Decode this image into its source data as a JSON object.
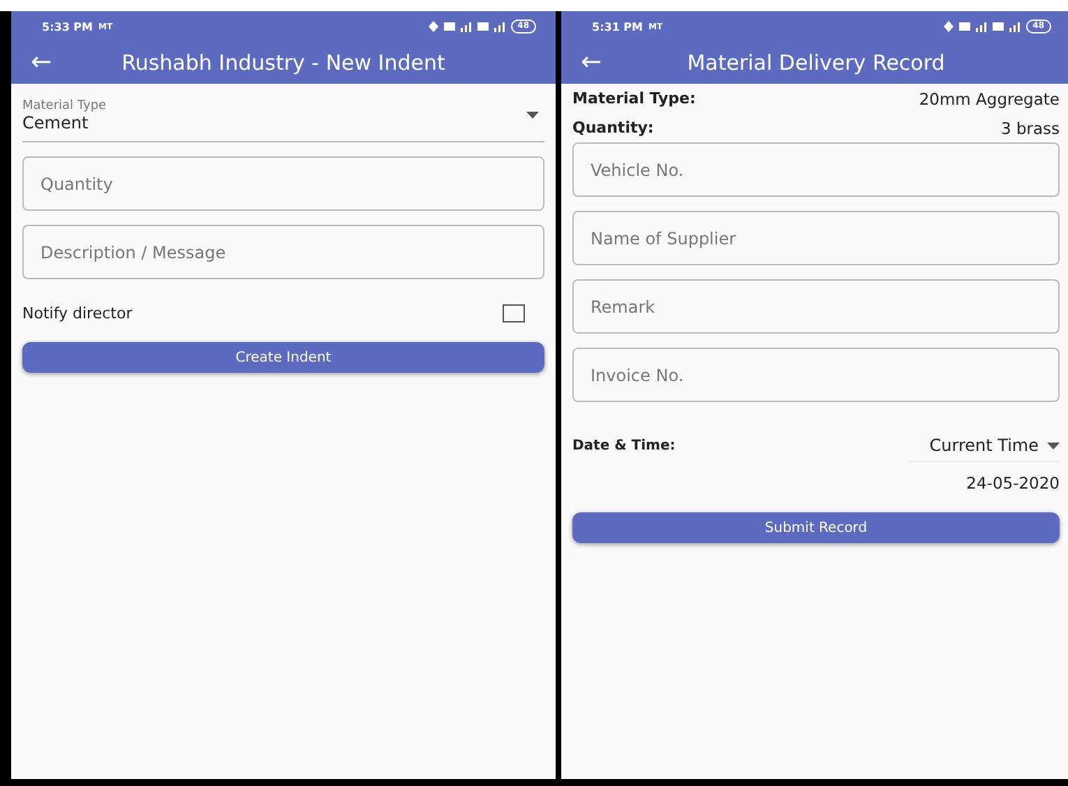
{
  "screens": [
    {
      "status_bar": {
        "time": "5:33 PM",
        "carrier": "MT",
        "battery": "48"
      },
      "title": "Rushabh Industry - New Indent",
      "back_icon": "←",
      "items": [
        {
          "kind": "dropdown",
          "label": "Material Type",
          "value": "Cement"
        },
        {
          "kind": "field",
          "placeholder": "Quantity"
        },
        {
          "kind": "field",
          "placeholder": "Description / Message"
        },
        {
          "kind": "checkbox",
          "label": "Notify director",
          "checked": false
        },
        {
          "kind": "button",
          "label": "Create Indent"
        }
      ]
    },
    {
      "status_bar": {
        "time": "5:31 PM",
        "carrier": "MT",
        "battery": "48"
      },
      "title": "Material Delivery Record",
      "back_icon": "←",
      "items": [
        {
          "kind": "info",
          "label": "Material Type:",
          "value": "20mm Aggregate"
        },
        {
          "kind": "info",
          "label": "Quantity:",
          "value": "3 brass"
        },
        {
          "kind": "field",
          "placeholder": "Vehicle No."
        },
        {
          "kind": "field",
          "placeholder": "Name of Supplier"
        },
        {
          "kind": "field",
          "placeholder": "Remark"
        },
        {
          "kind": "field",
          "placeholder": "Invoice No."
        },
        {
          "kind": "select",
          "label": "Date & Time:",
          "value": "Current Time"
        },
        {
          "kind": "date",
          "value": "24-05-2020"
        },
        {
          "kind": "button",
          "label": "Submit Record"
        }
      ]
    }
  ]
}
